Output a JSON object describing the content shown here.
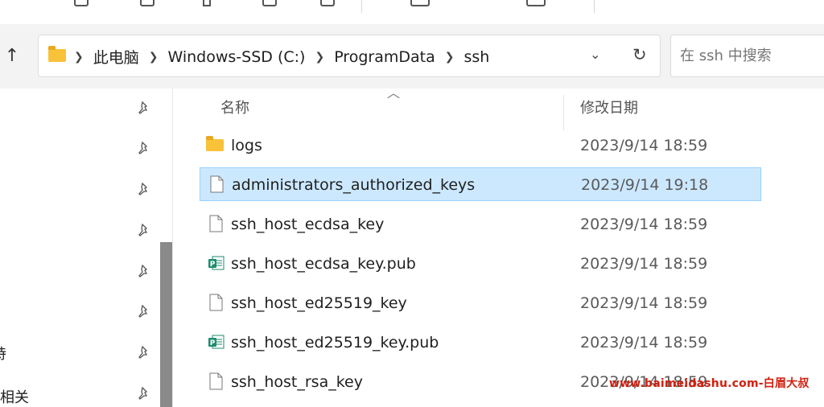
{
  "address_bar": {
    "crumbs": [
      "此电脑",
      "Windows-SSD (C:)",
      "ProgramData",
      "ssh"
    ],
    "chevron": "⌄",
    "refresh": "↻"
  },
  "search": {
    "placeholder": "在 ssh 中搜索"
  },
  "nav": {
    "up": "↑"
  },
  "left_pane": {
    "partial_labels": [
      "持",
      "案相关"
    ],
    "pin_count": 8
  },
  "columns": {
    "name": "名称",
    "date": "修改日期"
  },
  "files": [
    {
      "name": "logs",
      "modified": "2023/9/14 18:59",
      "type": "folder",
      "selected": false
    },
    {
      "name": "administrators_authorized_keys",
      "modified": "2023/9/14 19:18",
      "type": "file",
      "selected": true
    },
    {
      "name": "ssh_host_ecdsa_key",
      "modified": "2023/9/14 18:59",
      "type": "file",
      "selected": false
    },
    {
      "name": "ssh_host_ecdsa_key.pub",
      "modified": "2023/9/14 18:59",
      "type": "pub",
      "selected": false
    },
    {
      "name": "ssh_host_ed25519_key",
      "modified": "2023/9/14 18:59",
      "type": "file",
      "selected": false
    },
    {
      "name": "ssh_host_ed25519_key.pub",
      "modified": "2023/9/14 18:59",
      "type": "pub",
      "selected": false
    },
    {
      "name": "ssh_host_rsa_key",
      "modified": "2023/9/14 18:59",
      "type": "file",
      "selected": false
    }
  ],
  "watermark": "www.baimeidashu.com-白眉大叔",
  "colors": {
    "selection": "#cce8ff",
    "selection_border": "#99d1ff",
    "folder": "#f8c23a",
    "pub_icon": "#1e8c6e",
    "watermark": "#d02010"
  }
}
